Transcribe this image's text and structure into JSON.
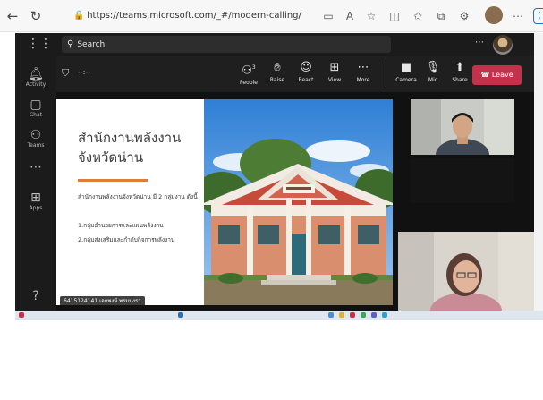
{
  "browser": {
    "url": "https://teams.microsoft.com/_#/modern-calling/"
  },
  "teams": {
    "search_placeholder": "Search",
    "rail": [
      {
        "label": "Activity",
        "icon": "bell-icon"
      },
      {
        "label": "Chat",
        "icon": "chat-icon"
      },
      {
        "label": "Teams",
        "icon": "teams-icon"
      },
      {
        "label": "Apps",
        "icon": "apps-icon"
      }
    ],
    "call": {
      "timer": "--:--",
      "controls": [
        {
          "label": "People",
          "icon": "people-icon",
          "badge": "3"
        },
        {
          "label": "Raise",
          "icon": "hand-icon"
        },
        {
          "label": "React",
          "icon": "smile-icon"
        },
        {
          "label": "View",
          "icon": "grid-icon"
        },
        {
          "label": "More",
          "icon": "more-icon"
        },
        {
          "label": "Camera",
          "icon": "camera-icon"
        },
        {
          "label": "Mic",
          "icon": "mic-icon"
        },
        {
          "label": "Share",
          "icon": "share-icon"
        }
      ],
      "leave_label": "Leave",
      "leave_color": "#c4314b"
    },
    "slide": {
      "title_line1": "สำนักงานพลังงาน",
      "title_line2": "จังหวัดน่าน",
      "body": "สำนักงานพลังงานจังหวัดน่าน มี 2 กลุ่มงาน ดังนี้",
      "item1": "1.กลุ่มอำนวยการและแผนพลังงาน",
      "item2": "2.กลุ่มส่งเสริมและกำกับกิจการพลังงาน",
      "accent_color": "#e07b39"
    },
    "presenter_name": "6415124141 เอกพงษ์ พรมบงรา"
  }
}
